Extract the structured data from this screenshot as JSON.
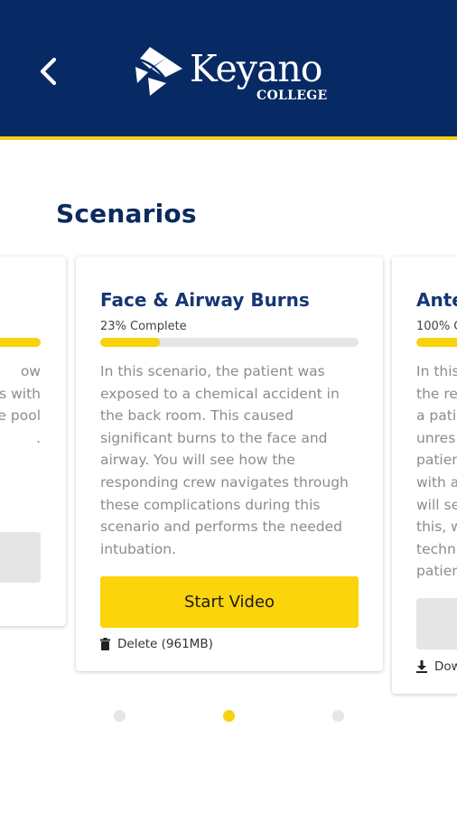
{
  "header": {
    "back_icon": "chevron-left-icon",
    "logo_name": "Keyano",
    "logo_sub": "COLLEGE",
    "bg_color": "#072a64",
    "accent_color": "#f4cf19"
  },
  "page": {
    "title": "Scenarios"
  },
  "cards": [
    {
      "title": "",
      "progress_label": "",
      "progress_fraction": 0.9,
      "description": "ow\ns with\ne pool\n.",
      "action_label": ""
    },
    {
      "title": "Face & Airway Burns",
      "progress_label": "23% Complete",
      "progress_fraction": 0.23,
      "description": "In this scenario, the patient was\nexposed to a chemical accident in\nthe back room. This caused\nsignificant burns to the face and\nairway. You will see how the\nresponding crew navigates through\nthese complications during this\nscenario and performs the needed\nintubation.",
      "button_label": "Start Video",
      "action_icon": "trash-icon",
      "action_label": "Delete (961MB)"
    },
    {
      "title": "Ante",
      "progress_label": "100% C",
      "progress_fraction": 1.0,
      "description": "In this\nthe re\na pati\nunres\npatien\nwith a\nwill se\nthis, w\ntechn\npatien",
      "action_icon": "download-icon",
      "action_label": "Dow"
    }
  ],
  "pager": {
    "count": 3,
    "active_index": 1
  }
}
